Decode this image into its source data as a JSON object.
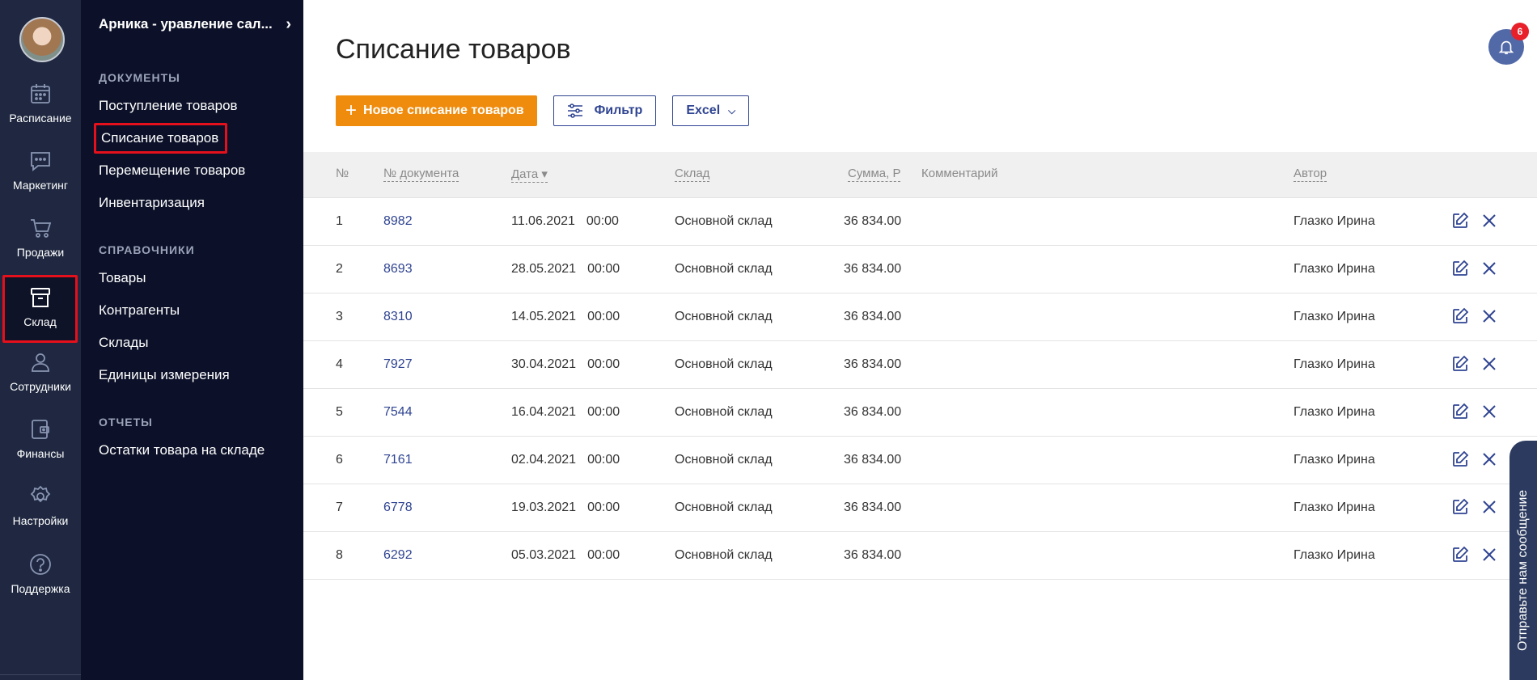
{
  "rail": {
    "items": [
      {
        "label": "Расписание",
        "icon": "calendar-icon"
      },
      {
        "label": "Маркетинг",
        "icon": "chat-icon"
      },
      {
        "label": "Продажи",
        "icon": "cart-icon"
      },
      {
        "label": "Склад",
        "icon": "archive-box-icon",
        "active": true
      },
      {
        "label": "Сотрудники",
        "icon": "user-icon"
      },
      {
        "label": "Финансы",
        "icon": "wallet-icon"
      },
      {
        "label": "Настройки",
        "icon": "gear-icon"
      },
      {
        "label": "Поддержка",
        "icon": "help-icon"
      }
    ]
  },
  "panel": {
    "company": "Арника - уравление сал...",
    "sections": {
      "documents": {
        "title": "ДОКУМЕНТЫ",
        "items": [
          "Поступление товаров",
          "Списание товаров",
          "Перемещение товаров",
          "Инвентаризация"
        ]
      },
      "references": {
        "title": "СПРАВОЧНИКИ",
        "items": [
          "Товары",
          "Контрагенты",
          "Склады",
          "Единицы измерения"
        ]
      },
      "reports": {
        "title": "ОТЧЕТЫ",
        "items": [
          "Остатки товара на складе"
        ]
      }
    }
  },
  "main": {
    "title": "Списание товаров",
    "notifications_count": "6",
    "toolbar": {
      "new_label": "Новое списание товаров",
      "filter_label": "Фильтр",
      "excel_label": "Excel"
    },
    "table": {
      "headers": {
        "num": "№",
        "doc": "№ документа",
        "date": "Дата ▾",
        "warehouse": "Склад",
        "sum": "Сумма, Р",
        "comment": "Комментарий",
        "author": "Автор"
      },
      "rows": [
        {
          "num": "1",
          "doc": "8982",
          "date": "11.06.2021",
          "time": "00:00",
          "warehouse": "Основной склад",
          "sum": "36 834.00",
          "comment": "",
          "author": "Глазко Ирина"
        },
        {
          "num": "2",
          "doc": "8693",
          "date": "28.05.2021",
          "time": "00:00",
          "warehouse": "Основной склад",
          "sum": "36 834.00",
          "comment": "",
          "author": "Глазко Ирина"
        },
        {
          "num": "3",
          "doc": "8310",
          "date": "14.05.2021",
          "time": "00:00",
          "warehouse": "Основной склад",
          "sum": "36 834.00",
          "comment": "",
          "author": "Глазко Ирина"
        },
        {
          "num": "4",
          "doc": "7927",
          "date": "30.04.2021",
          "time": "00:00",
          "warehouse": "Основной склад",
          "sum": "36 834.00",
          "comment": "",
          "author": "Глазко Ирина"
        },
        {
          "num": "5",
          "doc": "7544",
          "date": "16.04.2021",
          "time": "00:00",
          "warehouse": "Основной склад",
          "sum": "36 834.00",
          "comment": "",
          "author": "Глазко Ирина"
        },
        {
          "num": "6",
          "doc": "7161",
          "date": "02.04.2021",
          "time": "00:00",
          "warehouse": "Основной склад",
          "sum": "36 834.00",
          "comment": "",
          "author": "Глазко Ирина"
        },
        {
          "num": "7",
          "doc": "6778",
          "date": "19.03.2021",
          "time": "00:00",
          "warehouse": "Основной склад",
          "sum": "36 834.00",
          "comment": "",
          "author": "Глазко Ирина"
        },
        {
          "num": "8",
          "doc": "6292",
          "date": "05.03.2021",
          "time": "00:00",
          "warehouse": "Основной склад",
          "sum": "36 834.00",
          "comment": "",
          "author": "Глазко Ирина"
        }
      ]
    }
  },
  "feedback": {
    "label": "Отправьте нам сообщение"
  },
  "colors": {
    "rail_bg": "#1f2840",
    "panel_bg": "#0c1129",
    "accent_orange": "#ef8c0e",
    "link_blue": "#2f4492",
    "highlight_red": "#e5101b"
  }
}
